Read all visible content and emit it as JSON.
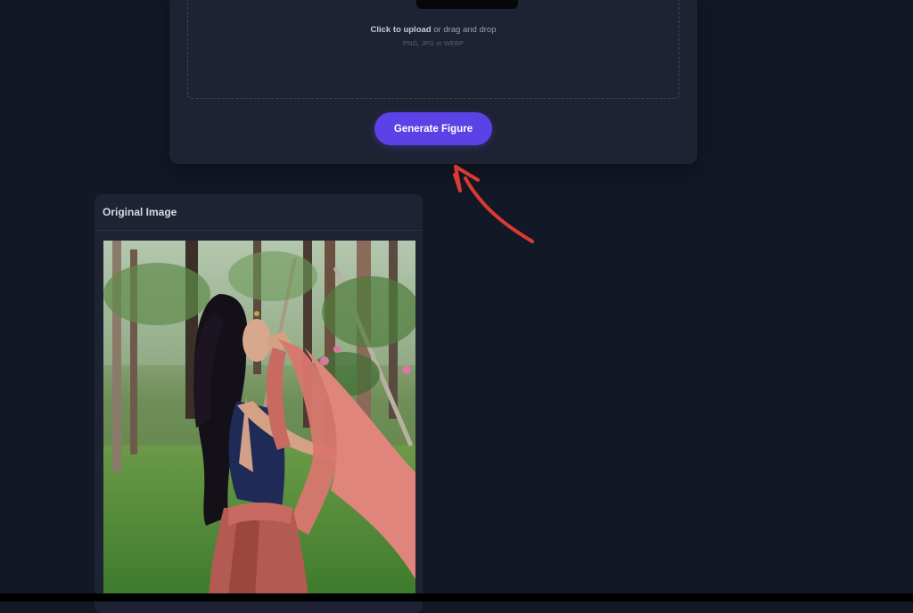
{
  "upload": {
    "prompt_action": "Click to upload",
    "prompt_rest": " or drag and drop",
    "formats": "PNG, JPG or WEBP"
  },
  "actions": {
    "generate_label": "Generate Figure"
  },
  "original_panel": {
    "title": "Original Image"
  },
  "colors": {
    "background": "#131826",
    "card": "#1e2333",
    "accent": "#5b42e6",
    "annotation_arrow": "#d93a32"
  }
}
